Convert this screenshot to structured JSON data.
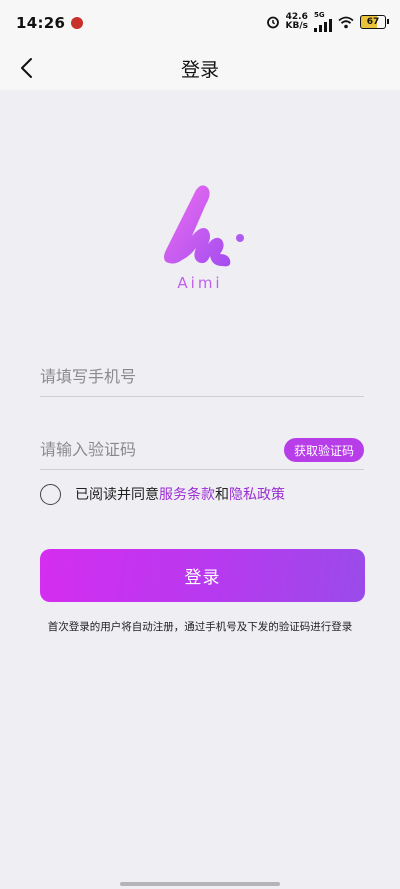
{
  "status_bar": {
    "time": "14:26",
    "speed_value": "42.6",
    "speed_unit": "KB/s",
    "network": "5G",
    "battery": "67"
  },
  "header": {
    "title": "登录"
  },
  "logo": {
    "name": "Aimi",
    "colors": [
      "#e84ef0",
      "#b05bf0"
    ]
  },
  "form": {
    "phone_placeholder": "请填写手机号",
    "code_placeholder": "请输入验证码",
    "get_code_label": "获取验证码",
    "agree_prefix": "已阅读并同意",
    "terms_label": "服务条款",
    "and_label": "和",
    "privacy_label": "隐私政策",
    "login_label": "登录",
    "hint": "首次登录的用户将自动注册，通过手机号及下发的验证码进行登录"
  },
  "colors": {
    "accent": "#b73de8",
    "link": "#9b2fd4",
    "background": "#efeef3"
  }
}
